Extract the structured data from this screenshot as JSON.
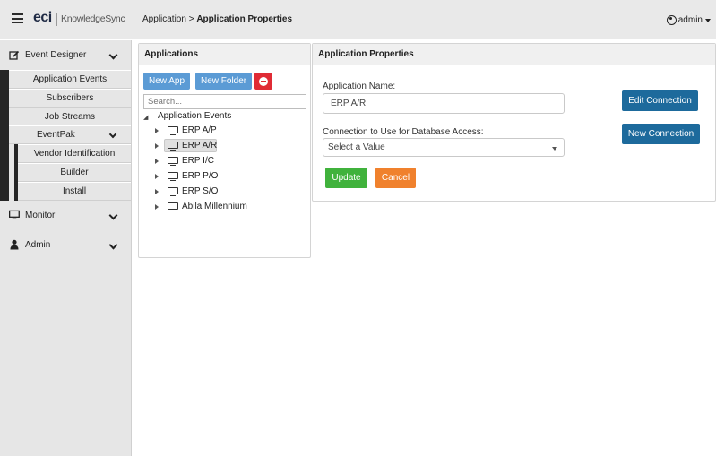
{
  "header": {
    "logo": "eci",
    "product": "KnowledgeSync",
    "breadcrumb_prefix": "Application > ",
    "breadcrumb_current": "Application Properties",
    "user": "admin"
  },
  "sidebar": {
    "event_designer": "Event Designer",
    "items": [
      "Application Events",
      "Subscribers",
      "Job Streams"
    ],
    "eventpak": "EventPak",
    "eventpak_items": [
      "Vendor Identification",
      "Builder",
      "Install"
    ],
    "monitor": "Monitor",
    "admin": "Admin"
  },
  "applications_panel": {
    "title": "Applications",
    "new_app": "New App",
    "new_folder": "New Folder",
    "search_placeholder": "Search...",
    "root": "Application Events",
    "nodes": [
      "ERP A/P",
      "ERP A/R",
      "ERP I/C",
      "ERP P/O",
      "ERP S/O",
      "Abila Millennium"
    ],
    "selected": "ERP A/R"
  },
  "properties_panel": {
    "title": "Application Properties",
    "name_label": "Application Name:",
    "name_value": "ERP A/R",
    "connection_label": "Connection to Use for Database Access:",
    "connection_placeholder": "Select a Value",
    "edit_connection": "Edit Connection",
    "new_connection": "New Connection",
    "update": "Update",
    "cancel": "Cancel"
  },
  "colors": {
    "primary_button": "#5b9bd5",
    "dark_button": "#1d6a9c",
    "update": "#40b23c",
    "cancel": "#f0812d",
    "delete": "#e02b35"
  }
}
